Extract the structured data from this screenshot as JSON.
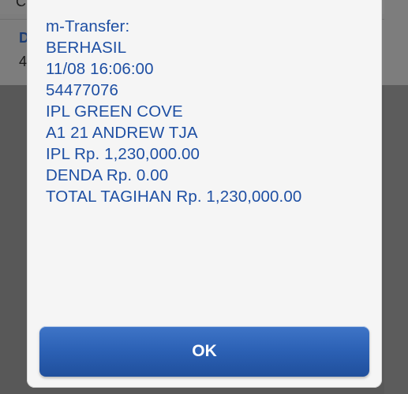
{
  "background": {
    "glyph_top": "C",
    "glyph_mid": "D",
    "glyph_low": "4"
  },
  "dialog": {
    "lines": [
      "m-Transfer:",
      "BERHASIL",
      "11/08 16:06:00",
      "54477076",
      "IPL GREEN COVE",
      "A1 21 ANDREW TJA",
      "IPL Rp. 1,230,000.00",
      "DENDA Rp. 0.00",
      "TOTAL TAGIHAN Rp. 1,230,000.00"
    ],
    "ok_label": "OK"
  },
  "colors": {
    "text_blue": "#1e4fa3",
    "button_blue": "#2d62b6",
    "overlay": "#5a5a5a"
  }
}
